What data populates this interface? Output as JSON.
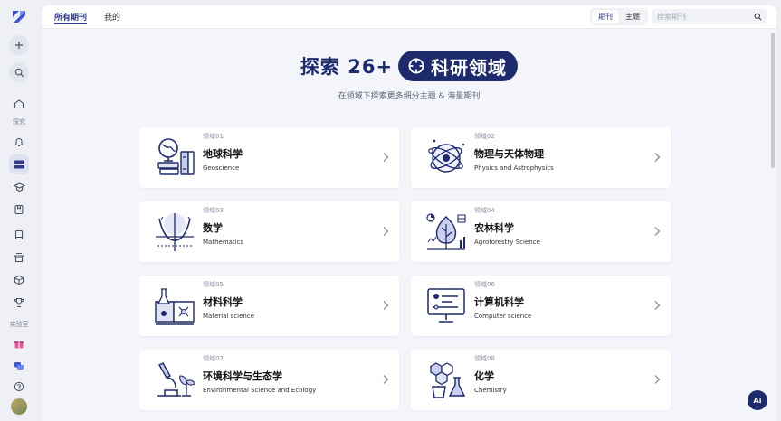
{
  "topbar": {
    "tabs": [
      {
        "label": "所有期刊"
      },
      {
        "label": "我的"
      }
    ],
    "segment": [
      {
        "label": "期刊"
      },
      {
        "label": "主题"
      }
    ],
    "search_placeholder": "搜索期刊"
  },
  "sidebar": {
    "section_explore": "探究",
    "section_lab": "实验室"
  },
  "hero": {
    "prefix": "探索 26+",
    "pill": "科研领域",
    "subtitle": "在领域下探索更多细分主题 & 海量期刊"
  },
  "fields": [
    {
      "tag": "领域01",
      "title": "地球科学",
      "en": "Geoscience",
      "icon": "globe-books-icon"
    },
    {
      "tag": "领域02",
      "title": "物理与天体物理",
      "en": "Physics and Astrophysics",
      "icon": "atom-icon"
    },
    {
      "tag": "领域03",
      "title": "数学",
      "en": "Mathematics",
      "icon": "graph-curve-icon"
    },
    {
      "tag": "领域04",
      "title": "农林科学",
      "en": "Agroforestry Science",
      "icon": "leaf-icon"
    },
    {
      "tag": "领域05",
      "title": "材料科学",
      "en": "Material science",
      "icon": "lab-book-icon"
    },
    {
      "tag": "领域06",
      "title": "计算机科学",
      "en": "Computer science",
      "icon": "computer-icon"
    },
    {
      "tag": "领域07",
      "title": "环境科学与生态学",
      "en": "Environmental Science and Ecology",
      "icon": "microscope-plant-icon"
    },
    {
      "tag": "领域08",
      "title": "化学",
      "en": "Chemistry",
      "icon": "molecule-flask-icon"
    }
  ],
  "ai_button": "Ai",
  "colors": {
    "primary": "#1d2a6b",
    "accent": "#2f3a8a",
    "background": "#eef0f6"
  }
}
